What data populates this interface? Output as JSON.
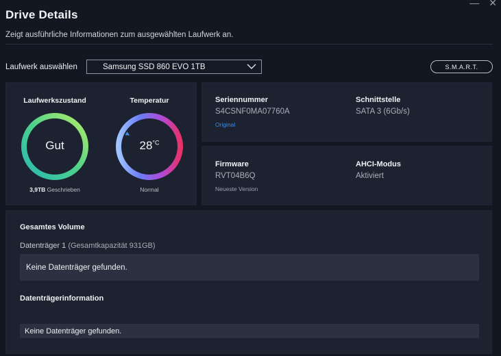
{
  "window": {
    "title": "Drive Details",
    "subtitle": "Zeigt ausführliche Informationen zum ausgewählten Laufwerk an.",
    "minimize_glyph": "—",
    "close_glyph": "✕"
  },
  "drive_select": {
    "label": "Laufwerk auswählen",
    "selected": "Samsung SSD 860 EVO 1TB",
    "icon": "chevron-down-icon"
  },
  "smart_button": {
    "label": "S.M.A.R.T."
  },
  "health": {
    "heading": "Laufwerkszustand",
    "status": "Gut",
    "written_value": "3,9TB",
    "written_label": "Geschrieben",
    "ring_colors": [
      "#b6ec6a",
      "#4fd18a",
      "#29b9b4"
    ]
  },
  "temperature": {
    "heading": "Temperatur",
    "value": "28",
    "unit": "°C",
    "status": "Normal",
    "level_percent": 28,
    "ring_colors": [
      "#9ec3ff",
      "#6b7cf5",
      "#b04ad8",
      "#e8316a"
    ],
    "marker_color": "#3d8ee6"
  },
  "serial": {
    "heading": "Seriennummer",
    "value": "S4CSNF0MA07760A",
    "link": "Original"
  },
  "interface": {
    "heading": "Schnittstelle",
    "value": "SATA 3 (6Gb/s)"
  },
  "firmware": {
    "heading": "Firmware",
    "value": "RVT04B6Q",
    "note": "Neueste Version"
  },
  "ahci": {
    "heading": "AHCI-Modus",
    "value": "Aktiviert"
  },
  "volume": {
    "heading": "Gesamtes Volume",
    "disk_name": "Datenträger 1",
    "disk_capacity": "(Gesamtkapazität 931GB)",
    "empty_message": "Keine Datenträger gefunden."
  },
  "disk_info": {
    "heading": "Datenträgerinformation",
    "empty_message": "Keine Datenträger gefunden."
  },
  "colors": {
    "background": "#121722",
    "panel": "#1c2230",
    "accent_link": "#3d8ee6"
  }
}
